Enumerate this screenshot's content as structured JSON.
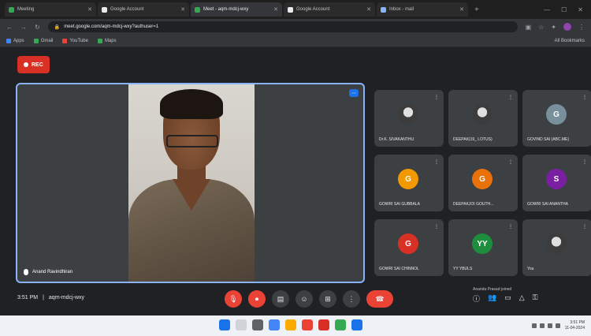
{
  "browser": {
    "tabs": [
      {
        "label": "Meeting",
        "fav_color": "#34a853",
        "active": false
      },
      {
        "label": "Google Account",
        "fav_color": "#e8eaed",
        "active": false
      },
      {
        "label": "Meet - aqm-mdcj-wxy",
        "fav_color": "#34a853",
        "active": true
      },
      {
        "label": "Google Account",
        "fav_color": "#e8eaed",
        "active": false
      },
      {
        "label": "Inbox - mail",
        "fav_color": "#8ab4f8",
        "active": false
      }
    ],
    "new_tab": "+",
    "url": "meet.google.com/aqm-mdcj-wxy?authuser=1",
    "bookmarks": [
      {
        "label": "Apps",
        "color": "#4285f4"
      },
      {
        "label": "Gmail",
        "color": "#34a853"
      },
      {
        "label": "YouTube",
        "color": "#ea4335"
      },
      {
        "label": "Maps",
        "color": "#34a853"
      }
    ],
    "bookmarks_right": "All Bookmarks"
  },
  "meeting": {
    "rec_label": "REC",
    "main_participant": "Anand Ravindhiran",
    "grid": [
      {
        "name": "Dr.K. SIVAKANTHU",
        "initial": "",
        "avatar_color": "#5f6368",
        "photo": true
      },
      {
        "name": "DEEPAK(19_ LOTUS)",
        "initial": "",
        "avatar_color": "#2b2b2b",
        "photo": true
      },
      {
        "name": "GOVIND SAI (ABC.ME)",
        "initial": "G",
        "avatar_color": "#78909c",
        "photo": false
      },
      {
        "name": "GOWRI SAI GUBBALA",
        "initial": "G",
        "avatar_color": "#f29900",
        "photo": false
      },
      {
        "name": "DEEPAKJOI GOUTH...",
        "initial": "G",
        "avatar_color": "#e8710a",
        "photo": false
      },
      {
        "name": "GOWRI SAI ANANTHA",
        "initial": "S",
        "avatar_color": "#7b1fa2",
        "photo": false
      },
      {
        "name": "GOWRI SAI CHINNOL",
        "initial": "G",
        "avatar_color": "#d93025",
        "photo": false
      },
      {
        "name": "YY YBULS",
        "initial": "YY",
        "avatar_color": "#1e8e3e",
        "photo": false
      },
      {
        "name": "You",
        "initial": "",
        "avatar_color": "#5f6368",
        "photo": true
      }
    ],
    "time": "3:51 PM",
    "meeting_code": "aqm-mdcj-wxy",
    "toast": "Ananda Prasad joined"
  },
  "controls": {
    "mic": "mic-off",
    "camera": "camera-off",
    "captions": "CC",
    "emoji": "emoji",
    "present": "present",
    "more": "more",
    "end": "end-call"
  },
  "taskbar": {
    "time": "3:51 PM",
    "date": "11-04-2024"
  }
}
